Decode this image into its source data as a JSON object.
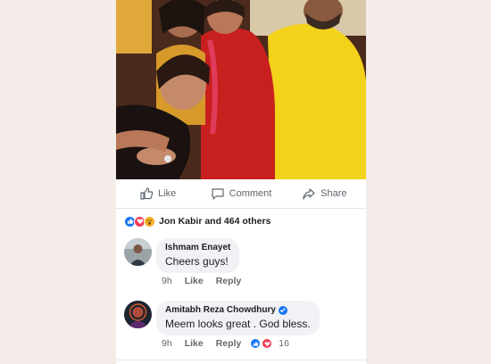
{
  "post": {
    "photo_alt": "Group photo",
    "actions": {
      "like_label": "Like",
      "comment_label": "Comment",
      "share_label": "Share"
    },
    "reactions_summary": "Jon Kabir and 464 others",
    "reaction_icons": [
      "like-icon",
      "love-icon",
      "wow-icon"
    ]
  },
  "comments": [
    {
      "author": "Ishmam Enayet",
      "text": "Cheers guys!",
      "time": "9h",
      "like_label": "Like",
      "reply_label": "Reply",
      "verified": false
    },
    {
      "author": "Amitabh Reza Chowdhury",
      "text": "Meem looks great . God bless.",
      "time": "9h",
      "like_label": "Like",
      "reply_label": "Reply",
      "verified": true,
      "reaction_count": "16"
    }
  ],
  "colors": {
    "page_bg": "#f3ece9",
    "accent_blue": "#1877f2",
    "love_red": "#f33e58",
    "wow_yellow": "#f7b125",
    "bubble_bg": "#f0f2f5",
    "muted_text": "#65676b"
  }
}
